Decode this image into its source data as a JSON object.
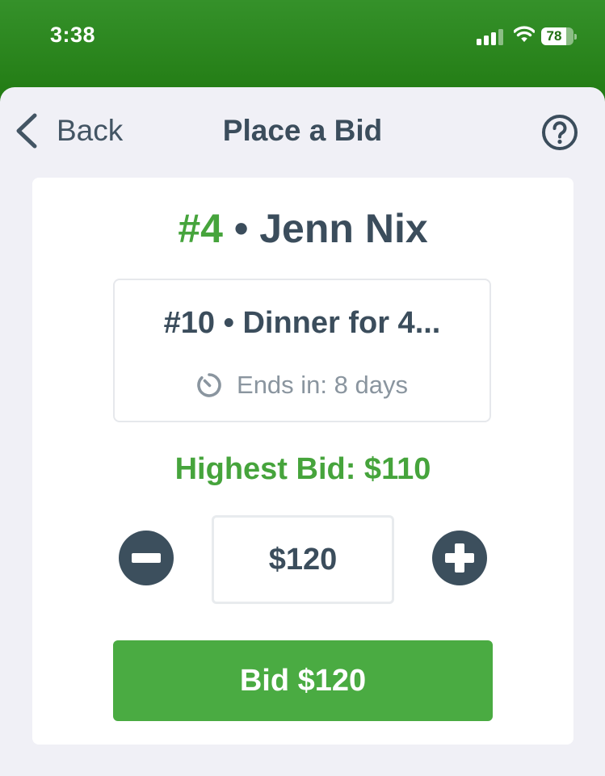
{
  "status_bar": {
    "time": "3:38",
    "battery_level": "78"
  },
  "nav": {
    "back_label": "Back",
    "title": "Place a Bid"
  },
  "bidder": {
    "number": "#4",
    "separator": " • ",
    "name": "Jenn Nix"
  },
  "item": {
    "title": "#10 • Dinner for 4...",
    "ends_in": "Ends in: 8 days"
  },
  "highest_bid": "Highest Bid: $110",
  "bid_amount": "$120",
  "bid_button_label": "Bid $120",
  "colors": {
    "header_green": "#2a8520",
    "accent_green": "#46a43c",
    "text_dark": "#3b4d5c",
    "muted_text": "#8a959f",
    "button_green": "#4aab42"
  },
  "icons": {
    "back": "chevron-left-icon",
    "help": "question-circle-icon",
    "timer": "timer-icon",
    "decrement": "minus-circle-icon",
    "increment": "plus-circle-icon"
  }
}
